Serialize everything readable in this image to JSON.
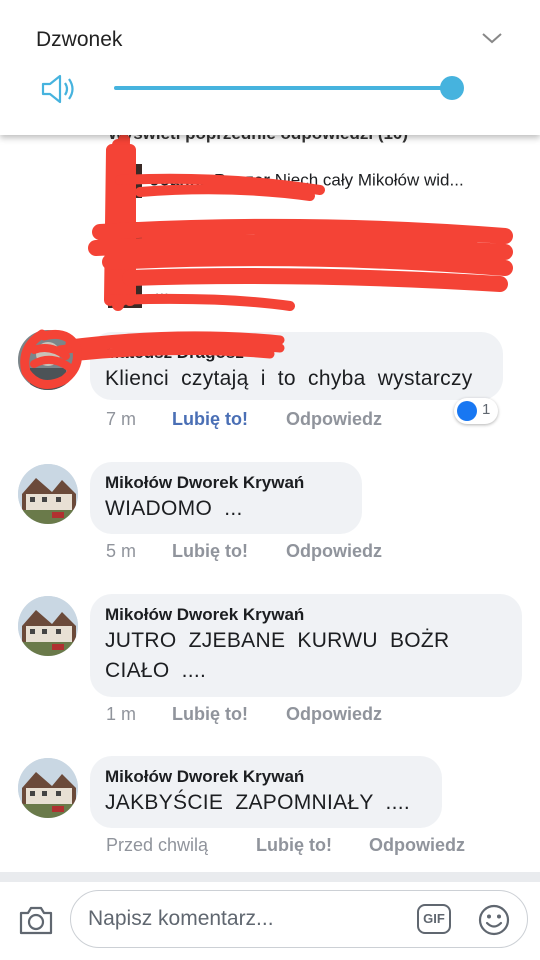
{
  "volume": {
    "title": "Dzwonek",
    "level": 1.0,
    "accent": "#46b3de",
    "icons": [
      "chevron-down-icon",
      "speaker-icon"
    ]
  },
  "previous_replies": {
    "link": "Wyświetl poprzednie odpowiedzi (10)",
    "items": [
      {
        "author": "Joanna Puszer",
        "text": "Niech cały Mikołów wid..."
      },
      {
        "author": "E",
        "text": "..."
      },
      {
        "author": "",
        "text": "..."
      }
    ]
  },
  "comments": [
    {
      "author": "Mateusz Dragosz",
      "text": "Klienci czytają i to chyba wystarczy",
      "time": "7 m",
      "like": "Lubię to!",
      "reply": "Odpowiedz",
      "liked": true,
      "reactions": "1"
    },
    {
      "author": "Mikołów Dworek Krywań",
      "text": "WIADOMO ...",
      "time": "5 m",
      "like": "Lubię to!",
      "reply": "Odpowiedz",
      "liked": false
    },
    {
      "author": "Mikołów Dworek Krywań",
      "text": "JUTRO  ZJEBANE  KURWU  BOŻR\nCIAŁO ....",
      "time": "1 m",
      "like": "Lubię to!",
      "reply": "Odpowiedz",
      "liked": false
    },
    {
      "author": "Mikołów Dworek Krywań",
      "text": "JAKBYŚCIE  ZAPOMNIAŁY ....",
      "time": "Przed chwilą",
      "like": "Lubię to!",
      "reply": "Odpowiedz",
      "liked": false
    }
  ],
  "composer": {
    "placeholder": "Napisz komentarz...",
    "gif_label": "GIF",
    "icons": [
      "camera-icon",
      "gif-icon",
      "emoji-icon"
    ]
  },
  "colors": {
    "bubble": "#f0f2f5",
    "link_blue": "#4a6fb5",
    "meta_grey": "#90949c",
    "redaction": "#f44336"
  }
}
